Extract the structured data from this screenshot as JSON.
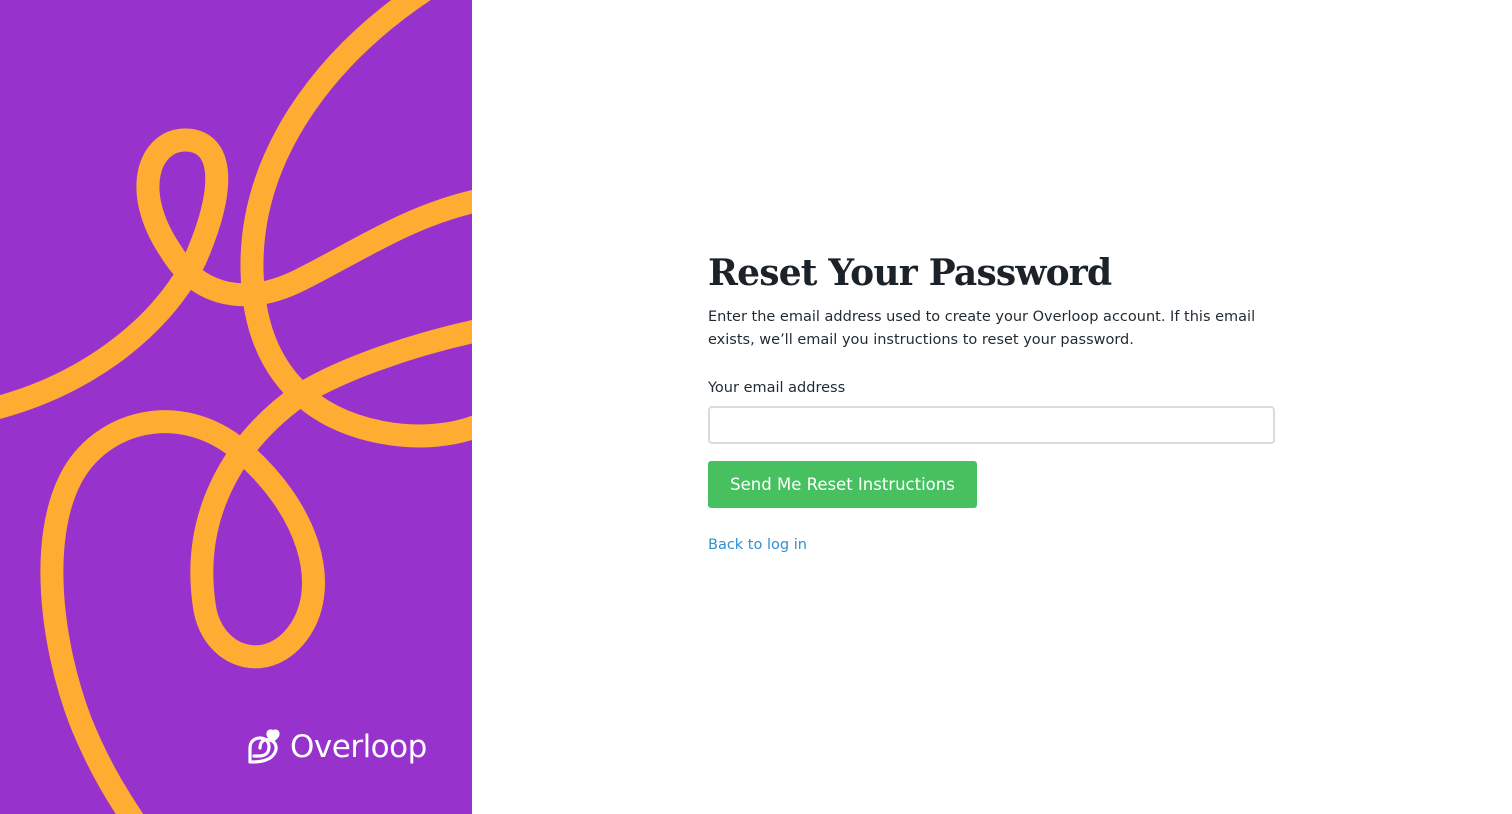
{
  "brand": {
    "name": "Overloop",
    "panel_color": "#9732cc",
    "squiggle_color": "#ffac33",
    "logo_icon": "overloop-logo-icon"
  },
  "form": {
    "title": "Reset Your Password",
    "description": "Enter the email address used to create your Overloop account. If this email exists, we’ll email you instructions to reset your password.",
    "email_label": "Your email address",
    "email_value": "",
    "email_placeholder": "",
    "submit_label": "Send Me Reset Instructions",
    "submit_color": "#47c160",
    "back_link_label": "Back to log in",
    "link_color": "#2f8fd0"
  }
}
